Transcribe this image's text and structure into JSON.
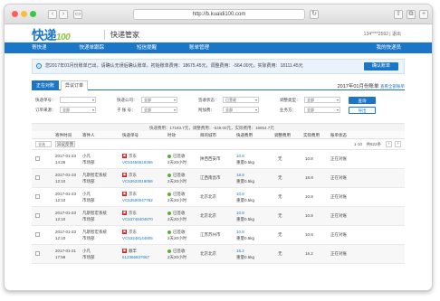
{
  "browser": {
    "url": "http://b.kuaidi100.com"
  },
  "app": {
    "logo_main": "快递",
    "logo_sub": "100",
    "title": "快递管家",
    "user": "134****2592 | 退出"
  },
  "nav": {
    "items": [
      "寄快递",
      "快递单跟踪",
      "短信提醒",
      "账单管理"
    ],
    "right": "我的快递员"
  },
  "notice": {
    "text": "您2017年01月份账单已出，请确认无误后确认账单。初始账单费用：18675.45元，调整费用：-564.00元，实际费用：18111.45元",
    "button": "确认账单"
  },
  "tabs": {
    "items": [
      "正在对账",
      "异议订单"
    ],
    "bill_label": "2017年01月份账单",
    "bill_link": "查看全部账单"
  },
  "filters": {
    "courier_no": {
      "label": "快递单号：",
      "value": ""
    },
    "company": {
      "label": "快递公司：",
      "value": "全部"
    },
    "status": {
      "label": "签收状态：",
      "value": "已签收"
    },
    "adjust": {
      "label": "调整类型：",
      "value": "全部"
    },
    "source": {
      "label": "订单来源：",
      "value": "全部"
    },
    "sub": {
      "label": "子  账  号：",
      "value": "全部"
    },
    "attach": {
      "label": "附加费：",
      "value": "全部"
    },
    "reply": {
      "label": "业务方：",
      "value": "全部"
    },
    "query_button": "查询",
    "export_button": "导出"
  },
  "summary": "快递费用：17183.7元，调整费用：-549.00元，实际费用：16654.7元",
  "table": {
    "headers": [
      "寄件时间",
      "寄件人",
      "快递单号",
      "时效",
      "目的城市",
      "快递费用",
      "调整费用",
      "实际费用",
      "账单状态"
    ],
    "select_label": "全选",
    "batch_button": "异议反馈",
    "pagination": "1-10　共822条",
    "prev": "‹",
    "next": "›",
    "rows": [
      {
        "date": "2017-01-23",
        "time": "14:26",
        "name": "小凡",
        "dept": "市场部",
        "courier": "京东",
        "waybill": "VC53456518366",
        "status": "已签收",
        "days": "2天20小时",
        "city": "陕西西安市",
        "fee": "10.8",
        "weight": "重量0.5kg",
        "adjust": "无",
        "actual": "10.8",
        "bill": "正在对账"
      },
      {
        "date": "2017-01-23",
        "time": "12:10",
        "name": "凡斯智宏系统",
        "dept": "市场部",
        "courier": "京东",
        "waybill": "VC53622019056",
        "status": "已签收",
        "days": "2天20小时",
        "city": "江西南昌市",
        "fee": "18.9",
        "weight": "重量0.5kg",
        "adjust": "无",
        "actual": "18.9",
        "bill": "正在对账"
      },
      {
        "date": "2017-01-23",
        "time": "12:10",
        "name": "小凡",
        "dept": "市场部",
        "courier": "京东",
        "waybill": "VC53500047762",
        "status": "已签收",
        "days": "2天20小时",
        "city": "北京北京",
        "fee": "10.8",
        "weight": "重量0.5kg",
        "adjust": "无",
        "actual": "10.8",
        "bill": "正在对账"
      },
      {
        "date": "2017-01-23",
        "time": "12:10",
        "name": "凡斯智宏系统",
        "dept": "市场部",
        "courier": "京东",
        "waybill": "VC53748404870",
        "status": "已签收",
        "days": "2天20小时",
        "city": "北京北京",
        "fee": "10.8",
        "weight": "重量0.5kg",
        "adjust": "无",
        "actual": "10.8",
        "bill": "正在对账"
      },
      {
        "date": "2017-01-23",
        "time": "12:10",
        "name": "凡斯智宏系统",
        "dept": "市场部",
        "courier": "京东",
        "waybill": "VC53248144805",
        "status": "已签收",
        "days": "2天20小时",
        "city": "江苏苏州市",
        "fee": "10.8",
        "weight": "重量0.5kg",
        "adjust": "无",
        "actual": "10.8",
        "bill": "正在对账"
      },
      {
        "date": "2017-01-21",
        "time": "17:59",
        "name": "小凡",
        "dept": "市场部",
        "courier": "顺丰",
        "waybill": "612366837067",
        "status": "已签收",
        "days": "2天20小时",
        "city": "北京北京",
        "fee": "16.2",
        "weight": "重量0.5kg",
        "adjust": "无",
        "actual": "16.2",
        "bill": "正在对账"
      }
    ]
  },
  "colors": {
    "primary": "#1c76c8",
    "logo_green": "#8cc63e",
    "courier_red": "#dd2222",
    "status_green": "#56b132"
  }
}
